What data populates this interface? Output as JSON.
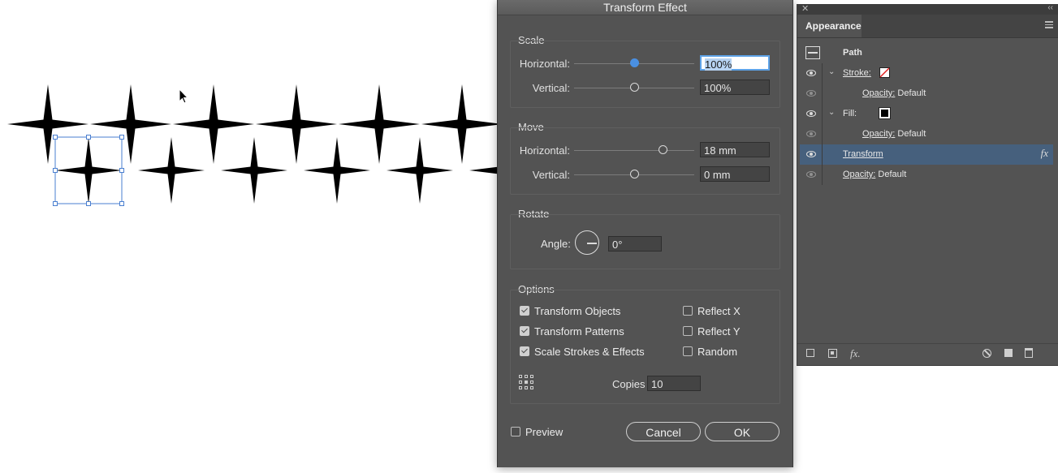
{
  "dialog": {
    "title": "Transform Effect",
    "scale": {
      "label": "Scale",
      "horizontal_label": "Horizontal:",
      "horizontal_value": "100%",
      "vertical_label": "Vertical:",
      "vertical_value": "100%"
    },
    "move": {
      "label": "Move",
      "horizontal_label": "Horizontal:",
      "horizontal_value": "18 mm",
      "vertical_label": "Vertical:",
      "vertical_value": "0 mm"
    },
    "rotate": {
      "label": "Rotate",
      "angle_label": "Angle:",
      "angle_value": "0°"
    },
    "options": {
      "label": "Options",
      "transform_objects": {
        "label": "Transform Objects",
        "checked": true
      },
      "transform_patterns": {
        "label": "Transform Patterns",
        "checked": true
      },
      "scale_strokes": {
        "label": "Scale Strokes & Effects",
        "checked": true
      },
      "reflect_x": {
        "label": "Reflect X",
        "checked": false
      },
      "reflect_y": {
        "label": "Reflect Y",
        "checked": false
      },
      "random": {
        "label": "Random",
        "checked": false
      },
      "copies_label": "Copies",
      "copies_value": "10"
    },
    "preview": {
      "label": "Preview",
      "checked": false
    },
    "cancel_label": "Cancel",
    "ok_label": "OK"
  },
  "appearance": {
    "tab_label": "Appearance",
    "rows": {
      "path": "Path",
      "stroke": "Stroke:",
      "stroke_opacity_label": "Opacity:",
      "stroke_opacity_value": "Default",
      "fill": "Fill:",
      "fill_opacity_label": "Opacity:",
      "fill_opacity_value": "Default",
      "transform": "Transform",
      "opacity_label": "Opacity:",
      "opacity_value": "Default"
    },
    "fx_glyph": "fx",
    "footer_fx": "fx."
  },
  "colors": {
    "dialog_bg": "#535353",
    "selection_accent": "#4a90e2",
    "selected_row": "#46607d",
    "artwork": "#000000"
  }
}
